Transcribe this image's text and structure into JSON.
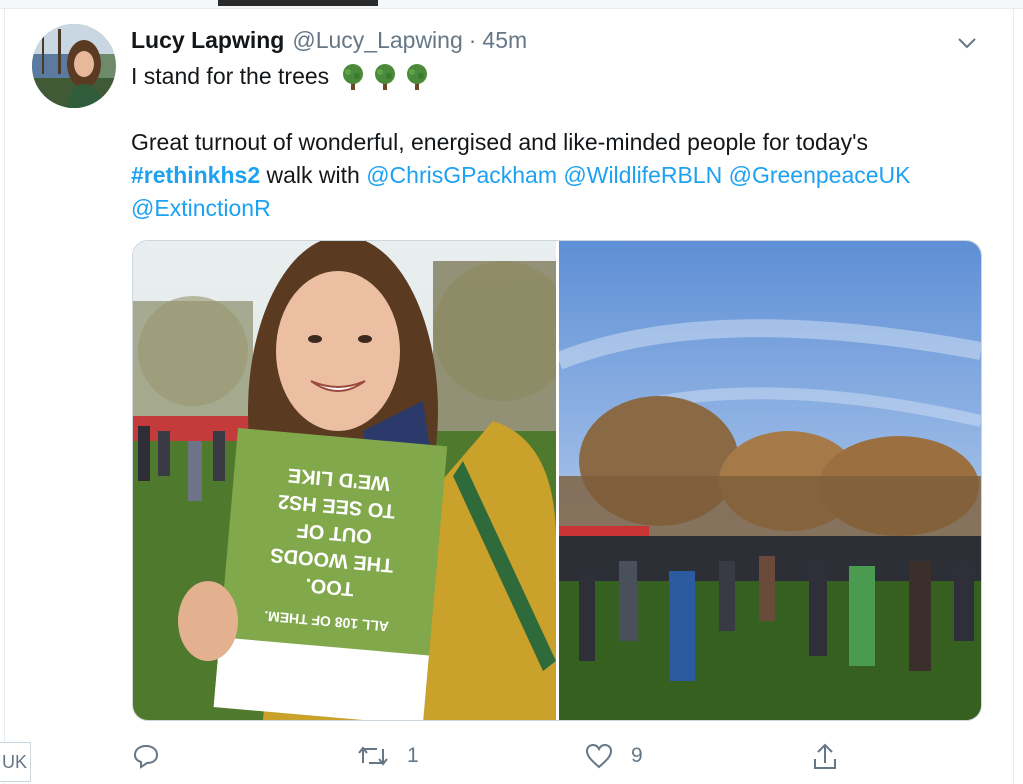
{
  "tweet": {
    "display_name": "Lucy Lapwing",
    "handle": "@Lucy_Lapwing",
    "separator": "·",
    "time": "45m",
    "line1": "I stand for the trees",
    "line2": "Great turnout of wonderful, energised and like-minded people  for today's",
    "hashtag": "#rethinkhs2",
    "line3_mid": " walk with  ",
    "mentions": [
      "@ChrisGPackham",
      "@WildlifeRBLN",
      "@GreenpeaceUK",
      "@ExtinctionR"
    ],
    "emoji_icon": "deciduous-tree-icon"
  },
  "media": {
    "left_photo": {
      "poster_lines": [
        "WE'D LIKE",
        "TO SEE HS2",
        "OUT OF",
        "THE WOODS",
        "TOO.",
        "ALL 108 OF THEM."
      ]
    }
  },
  "actions": {
    "reply_count": "",
    "retweet_count": "1",
    "like_count": "9"
  },
  "edge_chip": "UK",
  "colors": {
    "link": "#1da1f2",
    "muted": "#657786",
    "text": "#14171a"
  }
}
